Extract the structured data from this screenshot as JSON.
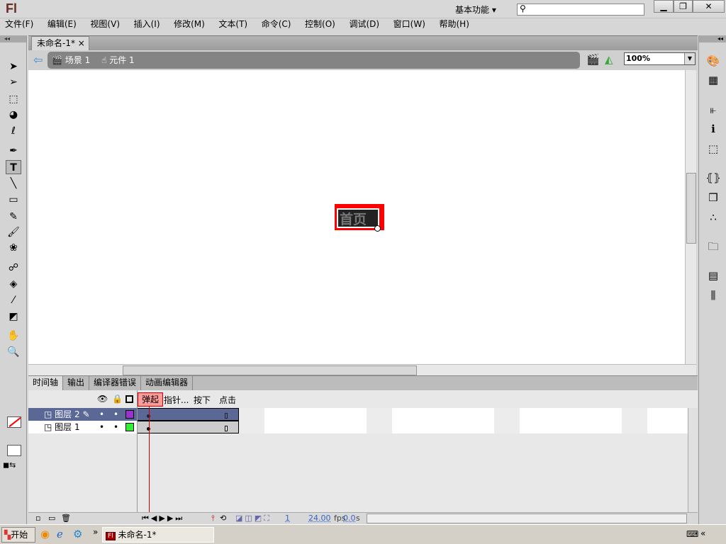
{
  "app": {
    "logo": "Fl",
    "workspace": "基本功能",
    "workspace_caret": "▾",
    "search_placeholder": "",
    "window_buttons": {
      "minimize": "▁",
      "restore": "❐",
      "close": "✕"
    }
  },
  "menu": [
    "文件(F)",
    "编辑(E)",
    "视图(V)",
    "插入(I)",
    "修改(M)",
    "文本(T)",
    "命令(C)",
    "控制(O)",
    "调试(D)",
    "窗口(W)",
    "帮助(H)"
  ],
  "tools": [
    {
      "icon": "selection-icon",
      "glyph": "➤"
    },
    {
      "icon": "subselection-icon",
      "glyph": "➢"
    },
    {
      "icon": "free-transform-icon",
      "glyph": "⬚"
    },
    {
      "icon": "3d-rotation-icon",
      "glyph": "◕"
    },
    {
      "icon": "lasso-icon",
      "glyph": "ℓ"
    },
    {
      "icon": "pen-icon",
      "glyph": "✒"
    },
    {
      "icon": "text-icon",
      "glyph": "T"
    },
    {
      "icon": "line-icon",
      "glyph": "╲"
    },
    {
      "icon": "rectangle-icon",
      "glyph": "▭"
    },
    {
      "icon": "pencil-icon",
      "glyph": "✎"
    },
    {
      "icon": "brush-icon",
      "glyph": "🖌"
    },
    {
      "icon": "deco-icon",
      "glyph": "❀"
    },
    {
      "icon": "bone-icon",
      "glyph": "☍"
    },
    {
      "icon": "paint-bucket-icon",
      "glyph": "◈"
    },
    {
      "icon": "eyedropper-icon",
      "glyph": "⁄"
    },
    {
      "icon": "eraser-icon",
      "glyph": "◩"
    },
    {
      "icon": "hand-icon",
      "glyph": "✋"
    },
    {
      "icon": "zoom-icon",
      "glyph": "🔍"
    }
  ],
  "document": {
    "tab": "未命名-1*",
    "close": "×",
    "crumbs": [
      {
        "label": "场景 1",
        "icon": "scene-icon"
      },
      {
        "label": "元件 1",
        "icon": "symbol-icon"
      }
    ],
    "zoom": "100%"
  },
  "stage_object": {
    "text": "首页",
    "bg": "#ff0000"
  },
  "timeline": {
    "tabs": [
      "时间轴",
      "输出",
      "编译器错误",
      "动画编辑器"
    ],
    "states": [
      "弹起",
      "指针...",
      "按下",
      "点击"
    ],
    "layers": [
      {
        "name": "图层 2",
        "color": "#9933cc",
        "selected": true
      },
      {
        "name": "图层 1",
        "color": "#33ee33",
        "selected": false
      }
    ],
    "current_frame": "1",
    "fps": "24.00",
    "fps_unit": "fps",
    "time": "0.0",
    "time_unit": "s"
  },
  "taskbar": {
    "start": "开始",
    "task": "未命名-1*",
    "more": "»"
  }
}
